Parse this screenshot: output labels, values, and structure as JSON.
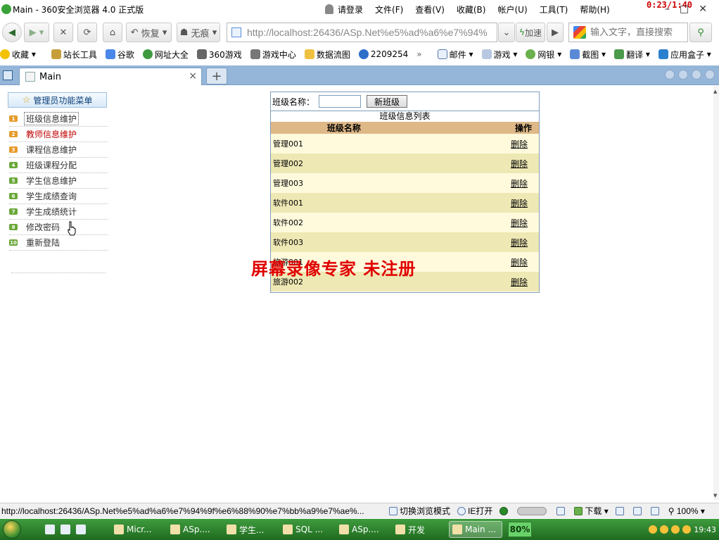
{
  "browser": {
    "title": "Main - 360安全浏览器 4.0 正式版",
    "login_label": "请登录",
    "menus": [
      "文件(F)",
      "查看(V)",
      "收藏(B)",
      "帐户(U)",
      "工具(T)",
      "帮助(H)"
    ],
    "timer": "0:23/1:40",
    "restore_label": "恢复",
    "notrace_label": "无痕",
    "url": "http://localhost:26436/ASp.Net%e5%ad%a6%e7%94%",
    "accelerate_label": "加速",
    "search_placeholder": "输入文字，直接搜索"
  },
  "bookmarks": {
    "favorites_label": "收藏",
    "items": [
      "站长工具",
      "谷歌",
      "网址大全",
      "360游戏",
      "游戏中心",
      "数据流图",
      "2209254"
    ],
    "more": "»",
    "right_items": [
      "邮件",
      "游戏",
      "网银",
      "截图",
      "翻译",
      "应用盒子"
    ]
  },
  "tab": {
    "title": "Main",
    "close": "×",
    "new_tab": "+"
  },
  "sidebar_menu": {
    "header": "管理员功能菜单",
    "items": [
      {
        "num": "1",
        "label": "班级信息维护",
        "color": "#e69b2b"
      },
      {
        "num": "2",
        "label": "教师信息维护",
        "color": "#e69b2b"
      },
      {
        "num": "3",
        "label": "课程信息维护",
        "color": "#e69b2b"
      },
      {
        "num": "4",
        "label": "班级课程分配",
        "color": "#6aa83a"
      },
      {
        "num": "5",
        "label": "学生信息维护",
        "color": "#6aa83a"
      },
      {
        "num": "6",
        "label": "学生成绩查询",
        "color": "#6aa83a"
      },
      {
        "num": "7",
        "label": "学生成绩统计",
        "color": "#6aa83a"
      },
      {
        "num": "8",
        "label": "修改密码",
        "color": "#6aa83a"
      },
      {
        "num": "10",
        "label": "重新登陆",
        "color": "#6aa83a"
      }
    ]
  },
  "class_panel": {
    "name_label": "班级名称：",
    "name_value": "",
    "new_button": "新班级",
    "list_title": "班级信息列表",
    "columns": [
      "班级名称",
      "操作"
    ],
    "delete_label": "删除",
    "rows": [
      "管理001",
      "管理002",
      "管理003",
      "软件001",
      "软件002",
      "软件003",
      "旅游001",
      "旅游002"
    ]
  },
  "watermark": "屏幕录像专家  未注册",
  "statusbar": {
    "url": "http://localhost:26436/ASp.Net%e5%ad%a6%e7%94%9f%e6%88%90%e7%bb%a9%e7%ae%...",
    "switch_mode": "切换浏览模式",
    "ie_open": "IE打开",
    "download": "下载",
    "zoom": "100%"
  },
  "taskbar": {
    "tasks": [
      "Micr...",
      "ASp....",
      "学生...",
      "SQL ...",
      "ASp....",
      "开发",
      "Main ..."
    ],
    "cpu": "80%",
    "clock": "19:43"
  }
}
